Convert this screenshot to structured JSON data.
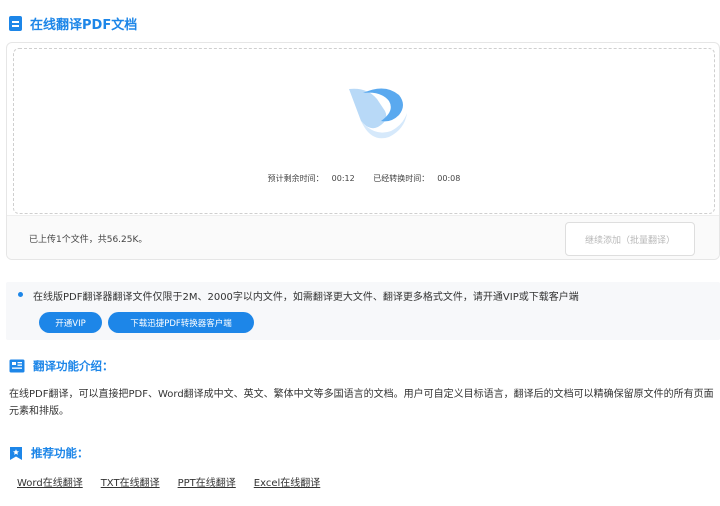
{
  "header": {
    "title": "在线翻译PDF文档"
  },
  "upload": {
    "remaining_label": "预计剩余时间：",
    "remaining_value": "00:12",
    "converted_label": "已经转换时间：",
    "converted_value": "00:08",
    "info": "已上传1个文件，共56.25K。",
    "continue_button": "继续添加（批量翻译）"
  },
  "notice": {
    "text": "在线版PDF翻译器翻译文件仅限于2M、2000字以内文件，如需翻译更大文件、翻译更多格式文件，请开通VIP或下载客户端",
    "vip_button": "开通VIP",
    "client_button": "下载迅捷PDF转换器客户端"
  },
  "intro": {
    "title": "翻译功能介绍：",
    "text": "在线PDF翻译，可以直接把PDF、Word翻译成中文、英文、繁体中文等多国语言的文档。用户可自定义目标语言，翻译后的文档可以精确保留原文件的所有页面元素和排版。"
  },
  "recommend": {
    "title": "推荐功能：",
    "links": [
      "Word在线翻译",
      "TXT在线翻译",
      "PPT在线翻译",
      "Excel在线翻译"
    ]
  },
  "colors": {
    "accent": "#1d86e8"
  },
  "icons": {
    "title": "document-icon",
    "intro": "intro-icon",
    "recommend": "star-flag-icon"
  }
}
